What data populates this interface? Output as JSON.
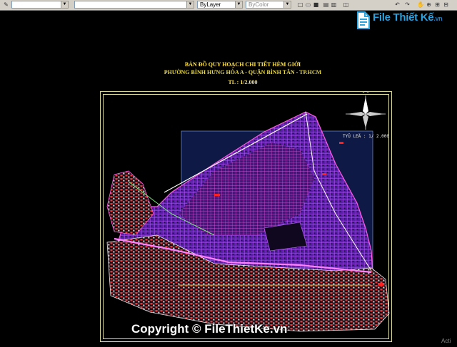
{
  "toolbar": {
    "linetype_value": "ByLayer",
    "color_value": "ByColor",
    "layer_value": ""
  },
  "watermark": {
    "logo_text": "File Thiết Kế",
    "logo_suffix": ".vn",
    "copyright_text": "Copyright © FileThietKe.vn"
  },
  "map": {
    "title_line1": "BẢN ĐỒ QUY HOẠCH CHI TIẾT HẺM GIỚI",
    "title_line2": "PHƯỜNG BÌNH HƯNG HÒA A - QUẬN BÌNH TÂN - TP.HCM",
    "title_line3": "TL : 1/2.000",
    "scale_note": "TYÛ LEÄ : 1/ 2.000"
  },
  "os": {
    "activate_text": "Acti"
  },
  "colors": {
    "background": "#000000",
    "title": "#ffe44a",
    "frame": "#d8d89a",
    "viewport": "#0e1a45",
    "parcels": "#a040ff",
    "roads": "#ff4fd8",
    "houses": "#ff3030",
    "logo": "#2aa3e0"
  }
}
